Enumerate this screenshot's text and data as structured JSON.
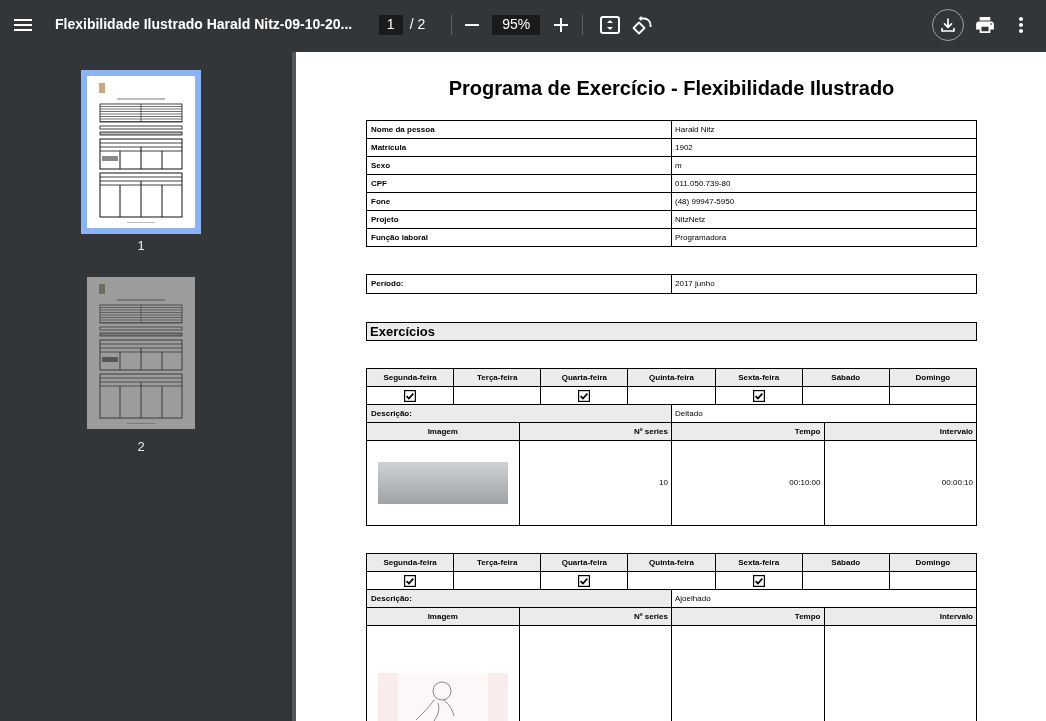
{
  "toolbar": {
    "title": "Flexibilidade Ilustrado Harald Nitz-09-10-20...",
    "page_number": "1",
    "page_count": "/ 2",
    "zoom": "95%"
  },
  "sidebar": {
    "thumbnails": [
      {
        "label": "1",
        "selected": true
      },
      {
        "label": "2",
        "selected": false
      }
    ]
  },
  "document": {
    "title": "Programa de Exercício - Flexibilidade Ilustrado",
    "person_fields": [
      {
        "label": "Nome da pessoa",
        "value": "Harald Nitz"
      },
      {
        "label": "Matrícula",
        "value": "1902"
      },
      {
        "label": "Sexo",
        "value": "m"
      },
      {
        "label": "CPF",
        "value": "011.050.739-80"
      },
      {
        "label": "Fone",
        "value": "(48) 99947-5950"
      },
      {
        "label": "Projeto",
        "value": "NitzNetz"
      },
      {
        "label": "Função laboral",
        "value": "Programadora"
      }
    ],
    "period": {
      "label": "Período:",
      "value": "2017 junho"
    },
    "section_title": "Exercícios",
    "exercises": [
      {
        "days": [
          {
            "name": "Segunda-feira",
            "checked": true
          },
          {
            "name": "Terça-feira",
            "checked": false
          },
          {
            "name": "Quarta-feira",
            "checked": true
          },
          {
            "name": "Quinta-feira",
            "checked": false
          },
          {
            "name": "Sexta-feira",
            "checked": true
          },
          {
            "name": "Sábado",
            "checked": false
          },
          {
            "name": "Domingo",
            "checked": false
          }
        ],
        "description_label": "Descrição:",
        "description": "Deitado",
        "columns": [
          "Imagem",
          "Nº series",
          "Tempo",
          "Intervalo"
        ],
        "image": {
          "kind": "photo"
        },
        "series": "10",
        "time": "00:10:00",
        "interval": "00:00:10"
      },
      {
        "days": [
          {
            "name": "Segunda-feira",
            "checked": true
          },
          {
            "name": "Terça-feira",
            "checked": false
          },
          {
            "name": "Quarta-feira",
            "checked": true
          },
          {
            "name": "Quinta-feira",
            "checked": false
          },
          {
            "name": "Sexta-feira",
            "checked": true
          },
          {
            "name": "Sábado",
            "checked": false
          },
          {
            "name": "Domingo",
            "checked": false
          }
        ],
        "description_label": "Descrição:",
        "description": "Ajoelhado",
        "columns": [
          "Imagem",
          "Nº series",
          "Tempo",
          "Intervalo"
        ],
        "image": {
          "kind": "sketch"
        }
      }
    ]
  }
}
